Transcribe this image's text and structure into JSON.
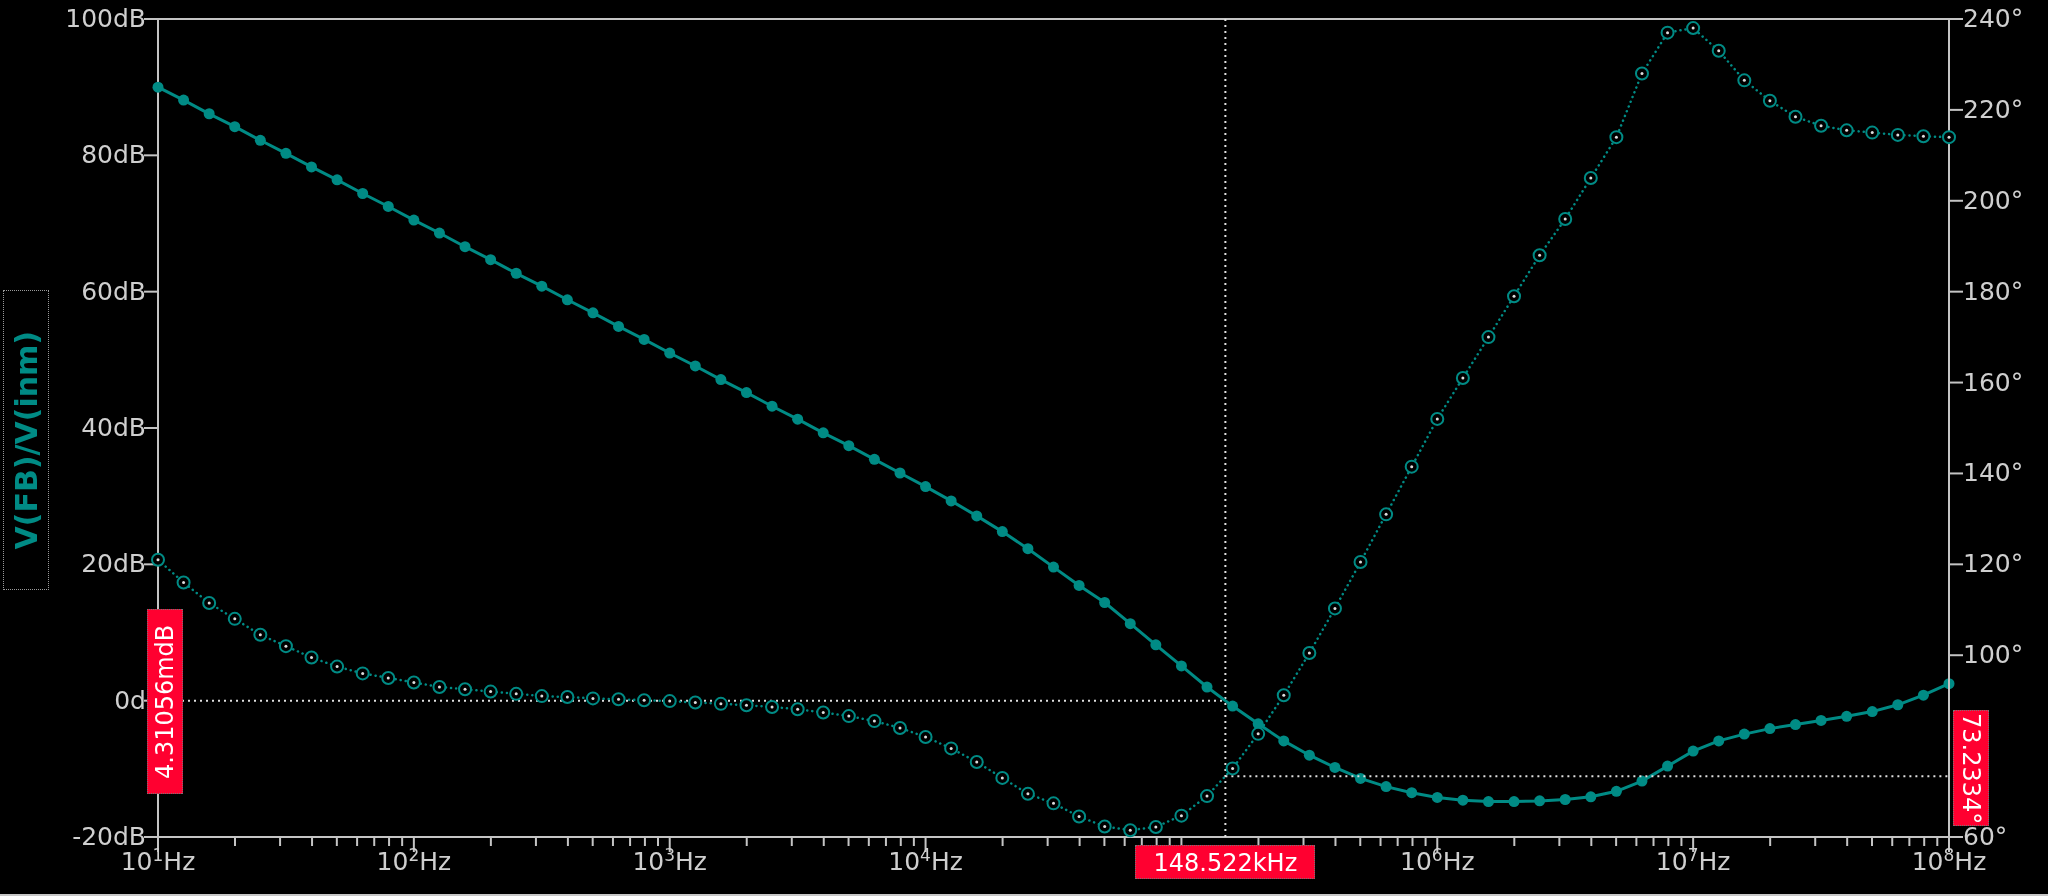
{
  "magnitude_chart": {
    "chart_data": {
      "type": "line",
      "ylabel": "V(FB)/V(inm)",
      "ylim": [
        -20,
        100
      ],
      "categories": [
        "10$^{1}$Hz",
        null,
        null,
        null,
        null,
        null,
        null,
        null,
        null,
        null,
        "10$^{2}$Hz",
        null,
        null,
        null,
        null,
        null,
        null,
        null,
        null,
        null,
        "10$^{3}$Hz",
        null,
        null,
        null,
        null,
        null,
        null,
        null,
        null,
        null,
        "10$^{4}$Hz",
        null,
        null,
        null,
        null,
        null,
        null,
        null,
        null,
        null,
        null,
        null,
        null,
        null,
        null,
        null,
        null,
        null,
        null,
        null,
        "10$^{6}$Hz",
        null,
        null,
        null,
        null,
        null,
        null,
        null,
        null,
        null,
        "10$^{7}$Hz",
        null,
        null,
        null,
        null,
        null,
        null,
        null,
        null,
        null,
        "10$^{8}$Hz"
      ],
      "yticks": [
        {
          "value": 100,
          "label": "100dB"
        },
        {
          "value": 80,
          "label": "80dB"
        },
        {
          "value": 60,
          "label": "60dB"
        },
        {
          "value": 40,
          "label": "40dB"
        },
        {
          "value": 20,
          "label": "20dB"
        },
        {
          "value": 0,
          "label": "0d"
        },
        {
          "value": -20,
          "label": "-20dB"
        }
      ],
      "series": [
        {
          "color": "#008b85",
          "line_style": "solid",
          "marker": "circle",
          "values": [
            90,
            88.1,
            86.1,
            84.2,
            82.2,
            80.3,
            78.3,
            76.4,
            74.4,
            72.5,
            70.5,
            68.6,
            66.6,
            64.7,
            62.7,
            60.8,
            58.8,
            56.9,
            54.9,
            53,
            51,
            49.1,
            47.1,
            45.2,
            43.2,
            41.3,
            39.3,
            37.4,
            35.4,
            33.4,
            31.4,
            29.3,
            27.1,
            24.8,
            22.3,
            19.6,
            16.9,
            14.4,
            11.3,
            8.2,
            5.1,
            2,
            -0.8,
            -3.4,
            -5.9,
            -8,
            -9.8,
            -11.4,
            -12.6,
            -13.5,
            -14.2,
            -14.6,
            -14.8,
            -14.8,
            -14.7,
            -14.5,
            -14.1,
            -13.3,
            -11.8,
            -9.6,
            -7.4,
            -5.9,
            -4.9,
            -4.1,
            -3.5,
            -2.9,
            -2.3,
            -1.6,
            -0.6,
            0.8,
            2.5
          ]
        }
      ],
      "annotations": [
        "148.522kHz",
        "4.31056mdB"
      ]
    }
  },
  "phase_chart": {
    "chart_data": {
      "type": "line",
      "ylim": [
        60,
        240
      ],
      "categories": [
        null,
        null,
        null,
        null,
        null,
        null,
        null,
        null,
        null,
        null,
        null,
        null,
        null,
        null,
        null,
        null,
        null,
        null,
        null,
        null,
        null,
        null,
        null,
        null,
        null,
        null,
        null,
        null,
        null,
        null,
        null,
        null,
        null,
        null,
        null,
        null,
        null,
        null,
        null,
        null,
        null,
        null,
        null,
        null,
        null,
        null,
        null,
        null,
        null,
        null,
        null,
        null,
        null,
        null,
        null,
        null,
        null,
        null,
        null,
        null,
        null,
        null,
        null,
        null,
        null,
        null,
        null,
        null,
        null,
        null,
        null
      ],
      "yticks": [
        {
          "value": 240,
          "label": "240°"
        },
        {
          "value": 220,
          "label": "220°"
        },
        {
          "value": 200,
          "label": "200°"
        },
        {
          "value": 180,
          "label": "180°"
        },
        {
          "value": 160,
          "label": "160°"
        },
        {
          "value": 140,
          "label": "140°"
        },
        {
          "value": 120,
          "label": "120°"
        },
        {
          "value": 100,
          "label": "100°"
        },
        {
          "value": 60,
          "label": "60°"
        }
      ],
      "series": [
        {
          "color": "#008b85",
          "line_style": "dotted",
          "marker": "circle",
          "values": [
            121,
            116,
            111.5,
            108,
            104.5,
            102,
            99.5,
            97.5,
            96,
            95,
            94,
            93,
            92.5,
            92,
            91.5,
            91,
            90.8,
            90.5,
            90.3,
            90.1,
            89.9,
            89.6,
            89.3,
            89,
            88.6,
            88.1,
            87.4,
            86.6,
            85.5,
            84,
            82,
            79.5,
            76.5,
            73,
            69.5,
            67.4,
            64.5,
            62.3,
            61.5,
            62.2,
            64.7,
            69,
            75.1,
            82.7,
            91.2,
            100.5,
            110.3,
            120.5,
            131,
            141.5,
            152,
            161,
            170,
            179,
            188,
            196,
            205,
            214,
            228,
            237,
            238,
            233,
            226.5,
            222,
            218.5,
            216.5,
            215.5,
            215,
            214.5,
            214.2,
            214
          ]
        }
      ],
      "annotations": [
        "73.2334°"
      ]
    }
  }
}
